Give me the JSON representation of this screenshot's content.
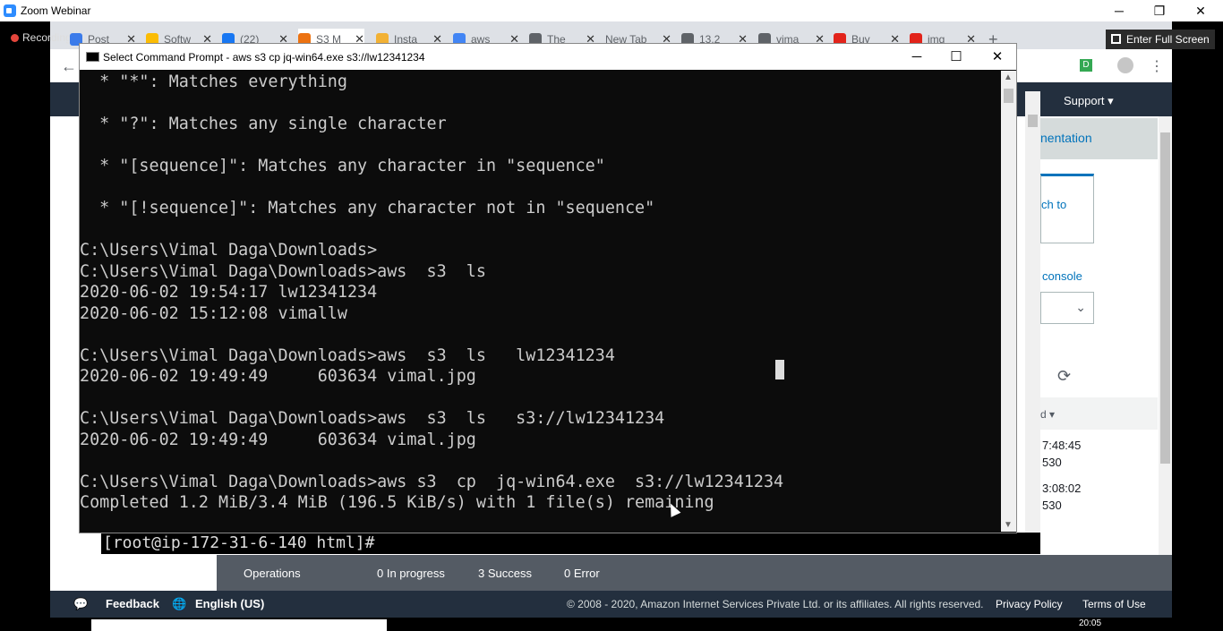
{
  "zoom": {
    "title": "Zoom Webinar",
    "recording": "Recording",
    "fullscreen": "Enter Full Screen"
  },
  "tabs": [
    {
      "label": "Post",
      "color": "#3b7bea"
    },
    {
      "label": "Softw",
      "color": "#fbbc04"
    },
    {
      "label": "(22)",
      "color": "#1877f2"
    },
    {
      "label": "S3 M",
      "color": "#ec7211"
    },
    {
      "label": "Insta",
      "color": "#f2b134"
    },
    {
      "label": "aws",
      "color": "#4285f4"
    },
    {
      "label": "The",
      "color": "#5f6368"
    },
    {
      "label": "New Tab",
      "color": "#ffffff"
    },
    {
      "label": "13.2",
      "color": "#5f6368"
    },
    {
      "label": "vima",
      "color": "#5f6368"
    },
    {
      "label": "Buy",
      "color": "#e2231a"
    },
    {
      "label": "img",
      "color": "#e2231a"
    }
  ],
  "new_tab": "+",
  "cmd": {
    "title": "Select Command Prompt - aws  s3  cp  jq-win64.exe  s3://lw12341234",
    "lines": [
      "  * \"*\": Matches everything",
      "",
      "  * \"?\": Matches any single character",
      "",
      "  * \"[sequence]\": Matches any character in \"sequence\"",
      "",
      "  * \"[!sequence]\": Matches any character not in \"sequence\"",
      "",
      "C:\\Users\\Vimal Daga\\Downloads>",
      "C:\\Users\\Vimal Daga\\Downloads>aws  s3  ls",
      "2020-06-02 19:54:17 lw12341234",
      "2020-06-02 15:12:08 vimallw",
      "",
      "C:\\Users\\Vimal Daga\\Downloads>aws  s3  ls   lw12341234",
      "2020-06-02 19:49:49     603634 vimal.jpg",
      "",
      "C:\\Users\\Vimal Daga\\Downloads>aws  s3  ls   s3://lw12341234",
      "2020-06-02 19:49:49     603634 vimal.jpg",
      "",
      "C:\\Users\\Vimal Daga\\Downloads>aws s3  cp  jq-win64.exe  s3://lw12341234",
      "Completed 1.2 MiB/3.4 MiB (196.5 KiB/s) with 1 file(s) remaining"
    ]
  },
  "terminal_prompt": "[root@ip-172-31-6-140 html]#",
  "aws": {
    "support": "Support ▾",
    "docs": "nentation",
    "switch": "ch to",
    "console": "console",
    "sort": "d ▾",
    "rows": [
      {
        "time": "7:48:45",
        "size": "530"
      },
      {
        "time": "3:08:02",
        "size": "530"
      }
    ]
  },
  "ops": {
    "operations": "Operations",
    "in_progress": "0 In progress",
    "success": "3 Success",
    "error": "0 Error"
  },
  "footer": {
    "feedback": "Feedback",
    "language": "English (US)",
    "copyright": "© 2008 - 2020, Amazon Internet Services Private Ltd. or its affiliates. All rights reserved.",
    "privacy": "Privacy Policy",
    "terms": "Terms of Use"
  },
  "clock": "20:05"
}
